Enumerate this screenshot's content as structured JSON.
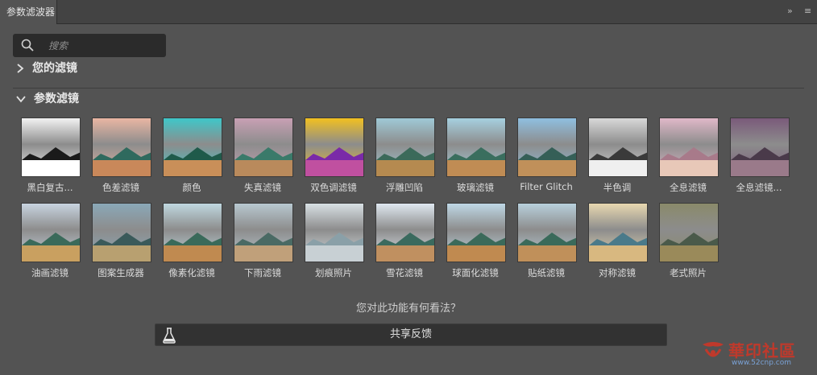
{
  "panel": {
    "tab_title": "参数滤波器",
    "expand_glyph": "»",
    "menu_glyph": "≡"
  },
  "search": {
    "placeholder": "搜索",
    "icon": "search-icon"
  },
  "sections": {
    "my_filters": "您的滤镜",
    "neural_filters": "参数滤镜"
  },
  "filters": [
    {
      "label": "黑白复古...",
      "sky": "#f2f2f2",
      "mtn": "#1a1a1a",
      "ground": "#ffffff"
    },
    {
      "label": "色差滤镜",
      "sky": "#e9b6a3",
      "mtn": "#2f6a5e",
      "ground": "#c9885a"
    },
    {
      "label": "颜色",
      "sky": "#3fc7c9",
      "mtn": "#1f5a4a",
      "ground": "#c98f59"
    },
    {
      "label": "失真滤镜",
      "sky": "#c8a0b4",
      "mtn": "#3a7a6a",
      "ground": "#b98a5c"
    },
    {
      "label": "双色调滤镜",
      "sky": "#f2c020",
      "mtn": "#7a2aa8",
      "ground": "#c050a0"
    },
    {
      "label": "浮雕凹陷",
      "sky": "#9fc9d6",
      "mtn": "#3b6a5a",
      "ground": "#b58a50"
    },
    {
      "label": "玻璃滤镜",
      "sky": "#a6d0e0",
      "mtn": "#3a6e5e",
      "ground": "#c08c54"
    },
    {
      "label": "Filter Glitch",
      "sky": "#8fbfe0",
      "mtn": "#355f57",
      "ground": "#c0905a"
    },
    {
      "label": "半色调",
      "sky": "#d8d8d8",
      "mtn": "#3a3a3a",
      "ground": "#efefef"
    },
    {
      "label": "全息滤镜",
      "sky": "#e0b8c8",
      "mtn": "#a87a8a",
      "ground": "#e8c8b8"
    },
    {
      "label": "全息滤镜...",
      "sky": "#7a5a7a",
      "mtn": "#4a3a4a",
      "ground": "#9a7a8a"
    },
    {
      "label": "油画滤镜",
      "sky": "#c8d4e0",
      "mtn": "#3a6a5a",
      "ground": "#c9a060"
    },
    {
      "label": "图案生成器",
      "sky": "#8aa8b8",
      "mtn": "#3a5a5a",
      "ground": "#b8a070"
    },
    {
      "label": "像素化滤镜",
      "sky": "#c0d8e0",
      "mtn": "#3a6a5a",
      "ground": "#c08a50"
    },
    {
      "label": "下雨滤镜",
      "sky": "#b8c8d0",
      "mtn": "#4a6a64",
      "ground": "#c0a07a"
    },
    {
      "label": "划痕照片",
      "sky": "#d8e0e4",
      "mtn": "#8aa0a8",
      "ground": "#c8d0d4"
    },
    {
      "label": "雪花滤镜",
      "sky": "#dfe8f0",
      "mtn": "#3a6a5e",
      "ground": "#c09060"
    },
    {
      "label": "球面化滤镜",
      "sky": "#bfd8e6",
      "mtn": "#3b6a5a",
      "ground": "#c08a50"
    },
    {
      "label": "贴纸滤镜",
      "sky": "#b8d0dc",
      "mtn": "#3a6a5a",
      "ground": "#c0905a"
    },
    {
      "label": "对称滤镜",
      "sky": "#e8d8b0",
      "mtn": "#4a7a8a",
      "ground": "#d8b880"
    },
    {
      "label": "老式照片",
      "sky": "#8a8a6a",
      "mtn": "#4a5a4a",
      "ground": "#9a8a5a"
    }
  ],
  "feedback": {
    "question": "您对此功能有何看法？",
    "button_label": "共享反馈",
    "icon": "flask-icon"
  },
  "watermark": {
    "title": "華印社區",
    "url": "www.52cnp.com"
  },
  "colors": {
    "panel_bg": "#535353",
    "tabbar_bg": "#434343",
    "search_bg": "#2b2b2b",
    "button_bg": "#323232",
    "watermark_red": "#c0392b"
  }
}
